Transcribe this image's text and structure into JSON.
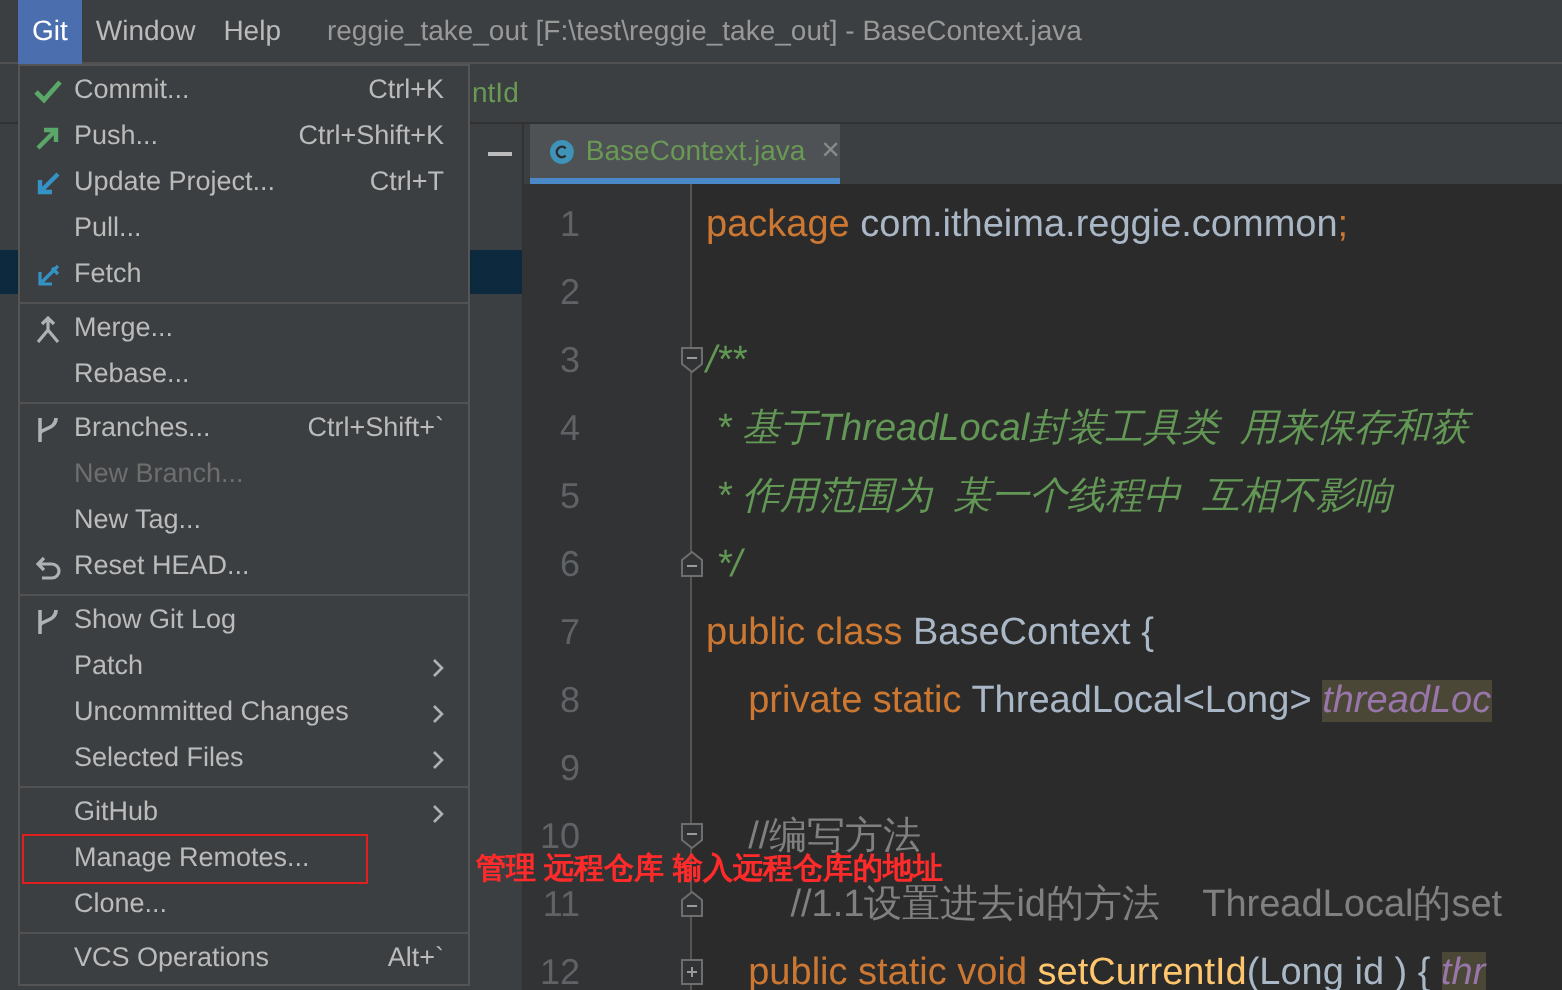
{
  "menu_bar": [
    {
      "label": "Git",
      "selected": true
    },
    {
      "label": "Window",
      "selected": false
    },
    {
      "label": "Help",
      "selected": false
    }
  ],
  "window": {
    "title": "reggie_take_out [F:\\test\\reggie_take_out] - BaseContext.java"
  },
  "breadcrumb": {
    "right_fragment": "ntId"
  },
  "editor_tab": {
    "label": "BaseContext.java",
    "close": "×"
  },
  "code_lines": [
    {
      "number": "1",
      "tokens": [
        {
          "kind": "keyword",
          "text": "package "
        },
        {
          "kind": "plain",
          "text": "com.itheima.reggie.common"
        },
        {
          "kind": "keyword",
          "text": ";"
        }
      ]
    },
    {
      "number": "2"
    },
    {
      "number": "3",
      "kind": "fold_start",
      "tokens": [
        {
          "kind": "doc",
          "text": "/**"
        }
      ]
    },
    {
      "number": "4",
      "tokens": [
        {
          "kind": "doc",
          "text": " * 基于ThreadLocal封装工具类  用来保存和获"
        }
      ]
    },
    {
      "number": "5",
      "tokens": [
        {
          "kind": "doc",
          "text": " * 作用范围为  某一个线程中  互相不影响"
        }
      ]
    },
    {
      "number": "6",
      "kind": "fold_end",
      "tokens": [
        {
          "kind": "doc",
          "text": " */"
        }
      ]
    },
    {
      "number": "7",
      "tokens": [
        {
          "kind": "keyword",
          "text": "public class "
        },
        {
          "kind": "plain",
          "text": "BaseContext {"
        }
      ]
    },
    {
      "number": "8",
      "tokens": [
        {
          "kind": "keyword",
          "text": "    private static "
        },
        {
          "kind": "plain",
          "text": "ThreadLocal<Long> "
        },
        {
          "kind": "field",
          "text": "threadLoc"
        }
      ]
    },
    {
      "number": "9"
    },
    {
      "number": "10",
      "kind": "fold_start",
      "tokens": [
        {
          "kind": "comment",
          "text": "    //编写方法"
        }
      ]
    },
    {
      "number": "11",
      "kind": "fold_end",
      "tokens": [
        {
          "kind": "comment",
          "text": "        //1.1设置进去id的方法    ThreadLocal的set"
        }
      ]
    },
    {
      "number": "12",
      "kind": "folded",
      "tokens": [
        {
          "kind": "keyword",
          "text": "    public static void "
        },
        {
          "kind": "method",
          "text": "setCurrentId"
        },
        {
          "kind": "plain",
          "text": "(Long id ) { "
        },
        {
          "kind": "field",
          "text": "thr"
        }
      ]
    }
  ],
  "git_menu": [
    {
      "kind": "item",
      "label": "Commit...",
      "shortcut": "Ctrl+K",
      "disabled": false
    },
    {
      "kind": "item",
      "label": "Push...",
      "shortcut": "Ctrl+Shift+K",
      "disabled": false
    },
    {
      "kind": "item",
      "label": "Update Project...",
      "shortcut": "Ctrl+T",
      "disabled": false
    },
    {
      "kind": "item",
      "label": "Pull...",
      "disabled": false
    },
    {
      "kind": "item",
      "label": "Fetch",
      "disabled": false
    },
    {
      "kind": "separator"
    },
    {
      "kind": "item",
      "label": "Merge...",
      "disabled": false
    },
    {
      "kind": "item",
      "label": "Rebase...",
      "disabled": false
    },
    {
      "kind": "separator"
    },
    {
      "kind": "item",
      "label": "Branches...",
      "shortcut": "Ctrl+Shift+`",
      "disabled": false
    },
    {
      "kind": "item",
      "label": "New Branch...",
      "disabled": true
    },
    {
      "kind": "item",
      "label": "New Tag...",
      "disabled": false
    },
    {
      "kind": "item",
      "label": "Reset HEAD...",
      "disabled": false
    },
    {
      "kind": "separator"
    },
    {
      "kind": "item",
      "label": "Show Git Log",
      "disabled": false
    },
    {
      "kind": "item",
      "label": "Patch",
      "submenu": true,
      "disabled": false
    },
    {
      "kind": "item",
      "label": "Uncommitted Changes",
      "submenu": true,
      "disabled": false
    },
    {
      "kind": "item",
      "label": "Selected Files",
      "submenu": true,
      "disabled": false
    },
    {
      "kind": "separator"
    },
    {
      "kind": "item",
      "label": "GitHub",
      "submenu": true,
      "disabled": false
    },
    {
      "kind": "item",
      "label": "Manage Remotes...",
      "highlighted": true,
      "disabled": false
    },
    {
      "kind": "item",
      "label": "Clone...",
      "disabled": false
    },
    {
      "kind": "separator"
    },
    {
      "kind": "item",
      "label": "VCS Operations",
      "shortcut": "Alt+`",
      "disabled": false
    }
  ],
  "annotation": "管理 远程仓库  输入远程仓库的地址"
}
